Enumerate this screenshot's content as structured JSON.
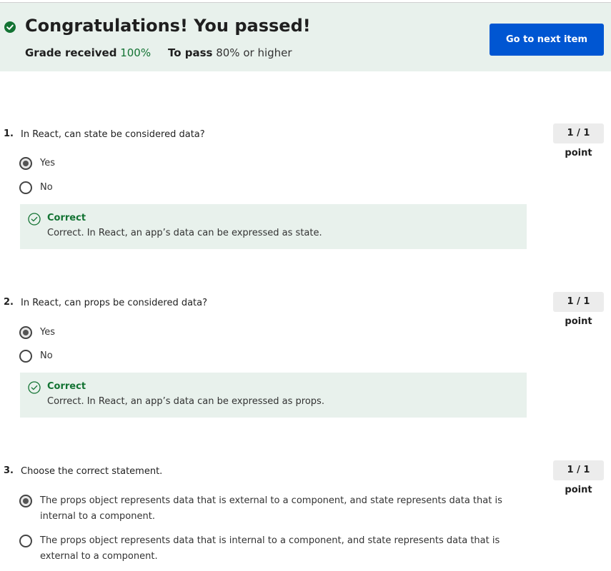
{
  "result": {
    "title": "Congratulations! You passed!",
    "grade_label": "Grade received",
    "grade_value": "100%",
    "pass_label": "To pass",
    "pass_value": "80% or higher",
    "next_button": "Go to next item",
    "icon": "check-circle-icon"
  },
  "questions": [
    {
      "number": "1.",
      "text": "In React, can state be considered data?",
      "points": "1 / 1 point",
      "options": [
        {
          "label": "Yes",
          "selected": true
        },
        {
          "label": "No",
          "selected": false
        }
      ],
      "feedback": {
        "title": "Correct",
        "text": "Correct. In React, an app’s data can be expressed as state."
      }
    },
    {
      "number": "2.",
      "text": "In React, can props be considered data?",
      "points": "1 / 1 point",
      "options": [
        {
          "label": "Yes",
          "selected": true
        },
        {
          "label": "No",
          "selected": false
        }
      ],
      "feedback": {
        "title": "Correct",
        "text": "Correct. In React, an app’s data can be expressed as props."
      }
    },
    {
      "number": "3.",
      "text": "Choose the correct statement.",
      "points": "1 / 1 point",
      "options": [
        {
          "label": "The props object represents data that is external to a component, and state represents data that is internal to a component.",
          "selected": true
        },
        {
          "label": "The props object represents data that is internal to a component, and state represents data that is external to a component.",
          "selected": false
        }
      ]
    }
  ],
  "colors": {
    "accent": "#0056d2",
    "success": "#137333",
    "banner_bg": "#e8f1ec"
  }
}
